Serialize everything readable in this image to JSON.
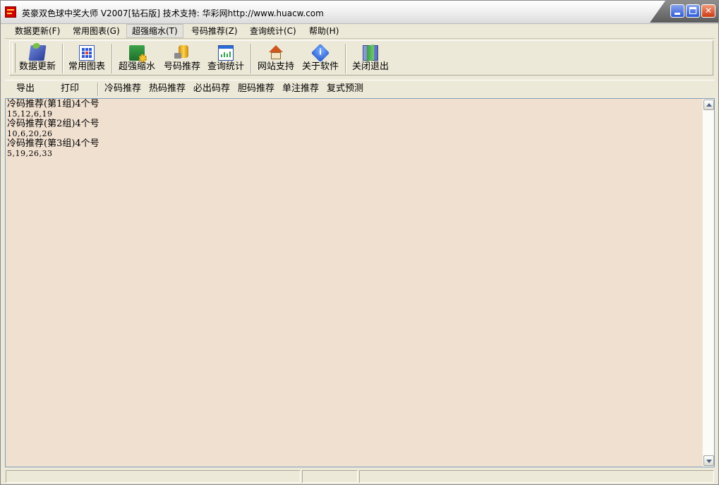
{
  "window": {
    "title": "英豪双色球中奖大师   V2007[钻石版]  技术支持: 华彩网http://www.huacw.com"
  },
  "menubar": {
    "items": [
      {
        "label": "数据更新(F)"
      },
      {
        "label": "常用图表(G)"
      },
      {
        "label": "超强缩水(T)"
      },
      {
        "label": "号码推荐(Z)"
      },
      {
        "label": "查询统计(C)"
      },
      {
        "label": "帮助(H)"
      }
    ]
  },
  "toolbar": {
    "buttons": [
      {
        "label": "数据更新",
        "icon": "book-update-icon"
      },
      {
        "label": "常用图表",
        "icon": "grid-chart-icon"
      },
      {
        "label": "超强缩水",
        "icon": "gear-book-icon"
      },
      {
        "label": "号码推荐",
        "icon": "coins-icon"
      },
      {
        "label": "查询统计",
        "icon": "chart-window-icon"
      },
      {
        "label": "网站支持",
        "icon": "house-icon"
      },
      {
        "label": "关于软件",
        "icon": "info-icon"
      },
      {
        "label": "关闭退出",
        "icon": "exit-door-icon"
      }
    ]
  },
  "toolbar2": {
    "items": [
      {
        "label": "导出"
      },
      {
        "label": "打印"
      },
      {
        "label": "冷码推荐"
      },
      {
        "label": "热码推荐"
      },
      {
        "label": "必出码荐"
      },
      {
        "label": "胆码推荐"
      },
      {
        "label": "单注推荐"
      },
      {
        "label": "复式预测"
      }
    ]
  },
  "content": {
    "lines": [
      "冷码推荐(第1组)4个号",
      "15,12,6,19",
      "冷码推荐(第2组)4个号",
      "10,6,20,26",
      "冷码推荐(第3组)4个号",
      "5,19,26,33"
    ]
  },
  "colors": {
    "textarea_background": "#f0e0d0",
    "window_background": "#ece9d8"
  }
}
